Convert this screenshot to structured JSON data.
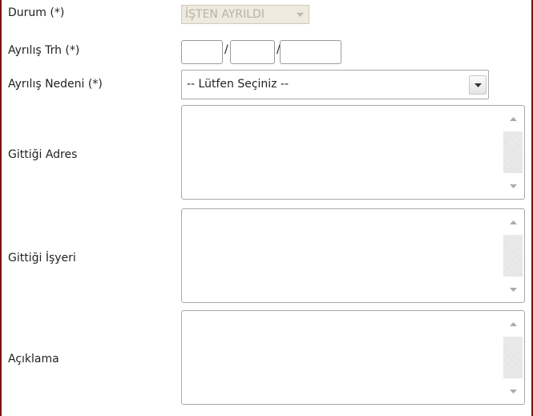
{
  "form": {
    "durum": {
      "label": "Durum (*)",
      "value": "İŞTEN AYRILDI"
    },
    "ayrilis_trh": {
      "label": "Ayrılış Trh (*)",
      "day": "",
      "month": "",
      "year": "",
      "separator_1": "/",
      "separator_2": "/"
    },
    "ayrilis_nedeni": {
      "label": "Ayrılış Nedeni (*)",
      "selected": "-- Lütfen Seçiniz --"
    },
    "gittigi_adres": {
      "label": "Gittiği Adres",
      "value": ""
    },
    "gittigi_isyeri": {
      "label": "Gittiği İşyeri",
      "value": ""
    },
    "aciklama": {
      "label": "Açıklama",
      "value": ""
    }
  },
  "colors": {
    "frame_border": "#7a1414",
    "disabled_bg": "#eeeae0",
    "disabled_text": "#b8b2a4"
  }
}
